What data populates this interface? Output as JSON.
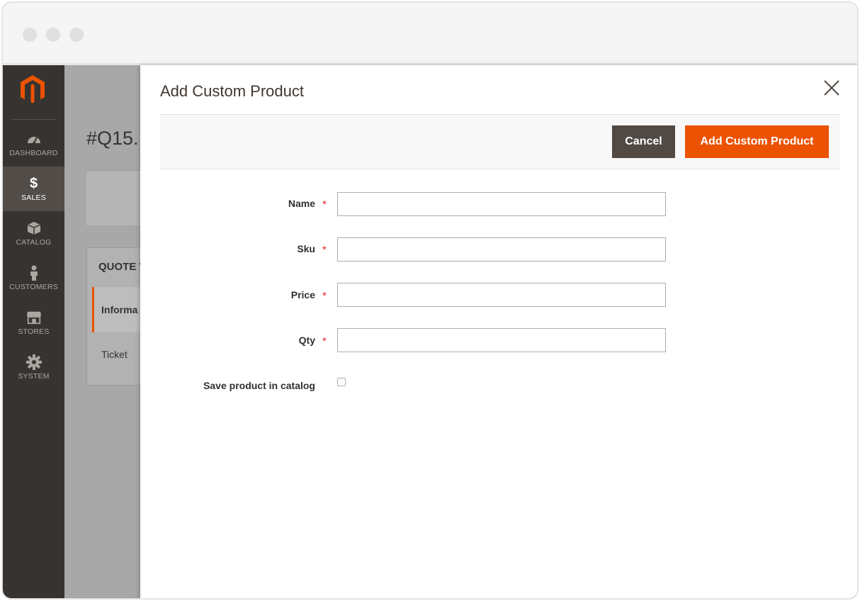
{
  "sidebar": {
    "logo_icon": "magento-logo",
    "items": [
      {
        "label": "DASHBOARD",
        "icon": "dashboard-gauge-icon"
      },
      {
        "label": "SALES",
        "icon": "dollar-icon",
        "active": true
      },
      {
        "label": "CATALOG",
        "icon": "box-icon"
      },
      {
        "label": "CUSTOMERS",
        "icon": "person-icon"
      },
      {
        "label": "STORES",
        "icon": "storefront-icon"
      },
      {
        "label": "SYSTEM",
        "icon": "gear-icon"
      }
    ]
  },
  "background_page": {
    "title": "#Q15.",
    "quote_header": "QUOTE V",
    "tab_information": "Informa",
    "tab_ticket": "Ticket"
  },
  "modal": {
    "title": "Add Custom Product",
    "cancel_label": "Cancel",
    "add_label": "Add Custom Product",
    "fields": [
      {
        "label": "Name",
        "required": true,
        "value": ""
      },
      {
        "label": "Sku",
        "required": true,
        "value": ""
      },
      {
        "label": "Price",
        "required": true,
        "value": ""
      },
      {
        "label": "Qty",
        "required": true,
        "value": ""
      }
    ],
    "save_in_catalog_label": "Save product in catalog",
    "save_in_catalog_checked": false,
    "required_mark": "*"
  },
  "colors": {
    "accent": "#eb5202",
    "sidebar": "#373330",
    "cancel_button": "#514943",
    "required": "#e22626"
  }
}
